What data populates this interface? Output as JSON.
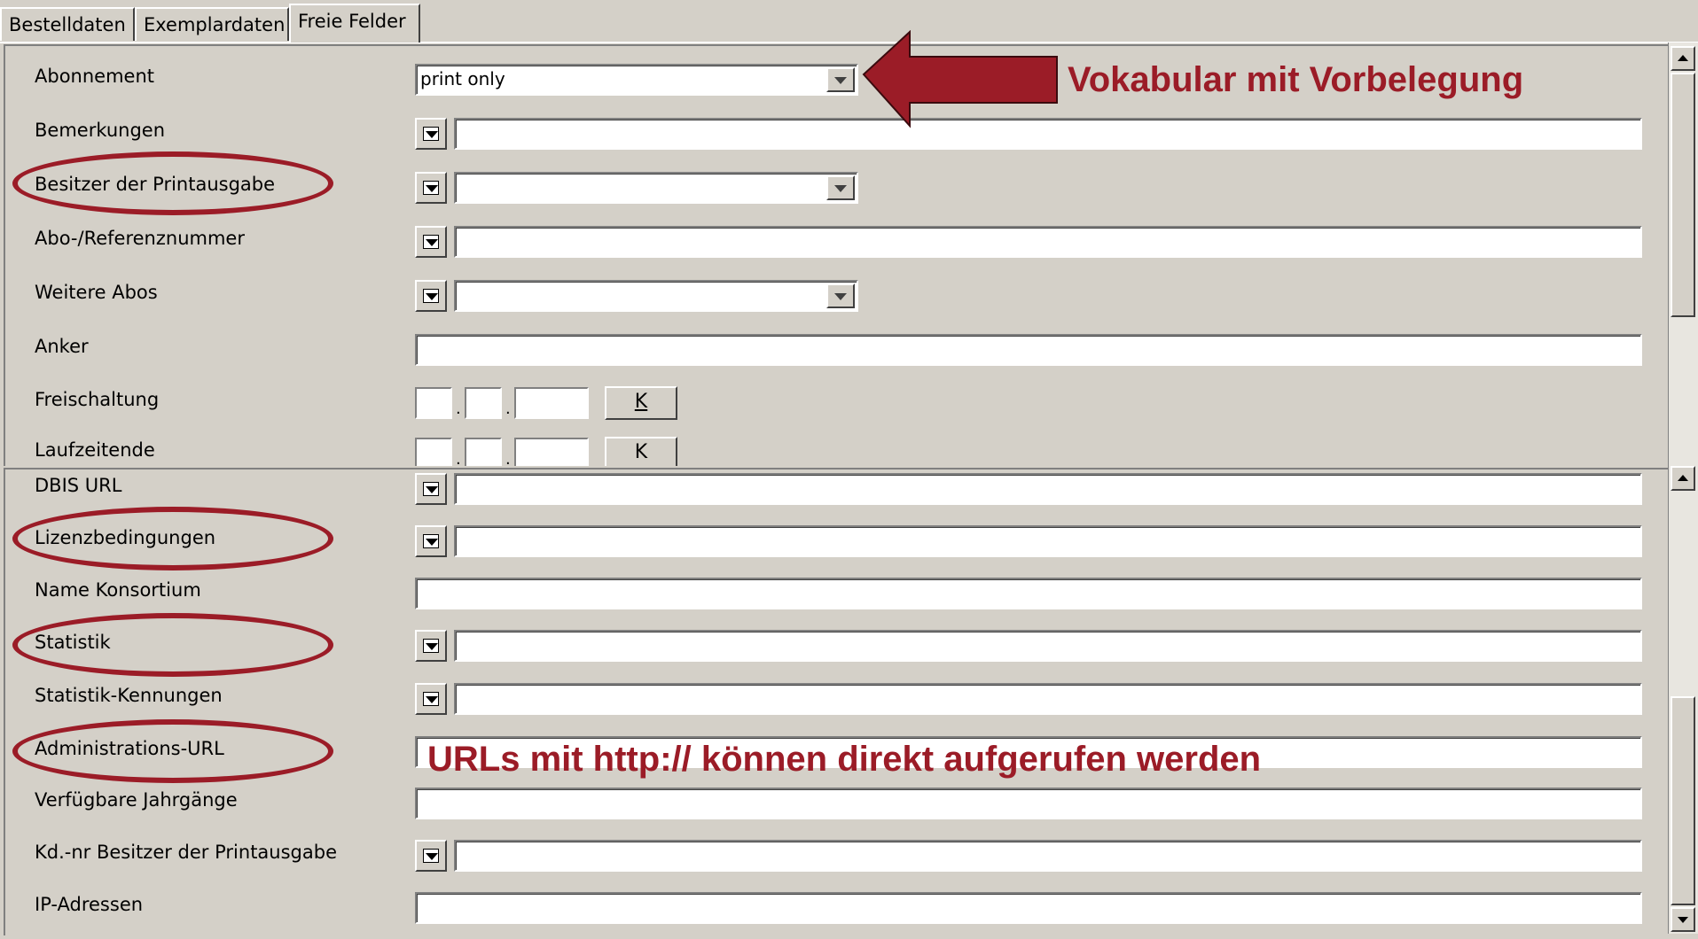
{
  "tabs": [
    "Bestelldaten",
    "Exemplardaten",
    "Freie Felder"
  ],
  "panel1": {
    "abonnement": {
      "label": "Abonnement",
      "value": "print only"
    },
    "bemerkungen": {
      "label": "Bemerkungen",
      "value": ""
    },
    "besitzer": {
      "label": "Besitzer der Printausgabe",
      "value": ""
    },
    "abo_ref": {
      "label": "Abo-/Referenznummer",
      "value": ""
    },
    "weitere_abos": {
      "label": "Weitere Abos",
      "value": ""
    },
    "anker": {
      "label": "Anker",
      "value": ""
    },
    "freischaltung": {
      "label": "Freischaltung",
      "button": "K"
    },
    "laufzeitende": {
      "label": "Laufzeitende",
      "button": "K"
    }
  },
  "panel2": {
    "dbis_url": {
      "label": "DBIS URL",
      "value": ""
    },
    "lizenz": {
      "label": "Lizenzbedingungen",
      "value": ""
    },
    "konsortium": {
      "label": "Name Konsortium",
      "value": ""
    },
    "statistik": {
      "label": "Statistik",
      "value": ""
    },
    "statistik_kennungen": {
      "label": "Statistik-Kennungen",
      "value": ""
    },
    "admin_url": {
      "label": "Administrations-URL",
      "value": ""
    },
    "jahrgaenge": {
      "label": "Verfügbare Jahrgänge",
      "value": ""
    },
    "kdnr": {
      "label": "Kd.-nr Besitzer der Printausgabe",
      "value": ""
    },
    "ip": {
      "label": "IP-Adressen",
      "value": ""
    }
  },
  "annotations": {
    "vokabular": "Vokabular mit Vorbelegung",
    "urls": "URLs mit http:// können direkt aufgerufen werden",
    "color": "#9b1c27"
  },
  "icons": {
    "dropdown": "dropdown-arrow-icon",
    "scroll_up": "scroll-up-icon",
    "scroll_down": "scroll-down-icon"
  }
}
